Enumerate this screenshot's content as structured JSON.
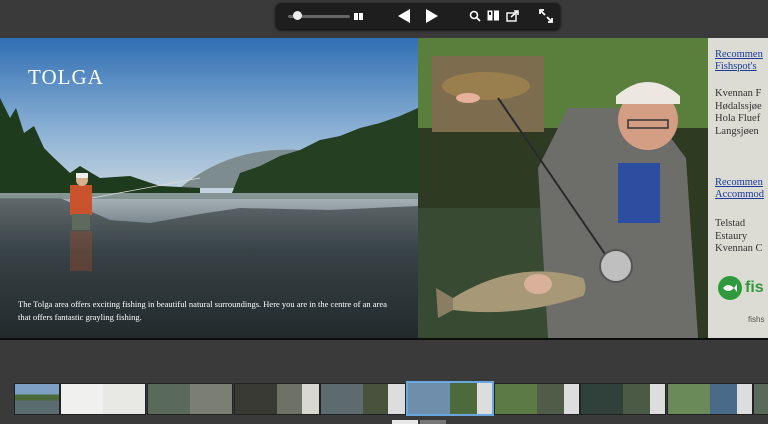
{
  "toolbar": {
    "icons": [
      "zoom-slider",
      "two-page-icon",
      "prev-arrow-icon",
      "next-arrow-icon",
      "search-icon",
      "bookmark-icon",
      "share-icon",
      "fullscreen-icon"
    ],
    "zoom_level": 0.1
  },
  "left_page": {
    "title": "TOLGA",
    "caption": "The Tolga area offers exciting fishing in beautiful natural surroundings. Here you are in the centre of an area that offers fantastic grayling fishing."
  },
  "right_page": {
    "sidebar": {
      "heading1_line1": "Recommen",
      "heading1_line2": "Fishspot's",
      "spots": [
        "Kvennan F",
        "Hødalssjøe",
        "Hola Fluef",
        "Langsjøen"
      ],
      "heading2_line1": "Recommen",
      "heading2_line2": "Accommod",
      "accommodations": [
        "Telstad",
        "Estaury",
        "Kvennan C"
      ],
      "logo_text": "fis",
      "footer_text": "fishs"
    }
  },
  "thumbnails": {
    "count": 9,
    "active_index": 4
  },
  "colors": {
    "toolbar_bg": "#1e1e1e",
    "background": "#3a3a3a",
    "sidebar_bg": "#dcdcd4",
    "accent": "#2e9a3c"
  }
}
